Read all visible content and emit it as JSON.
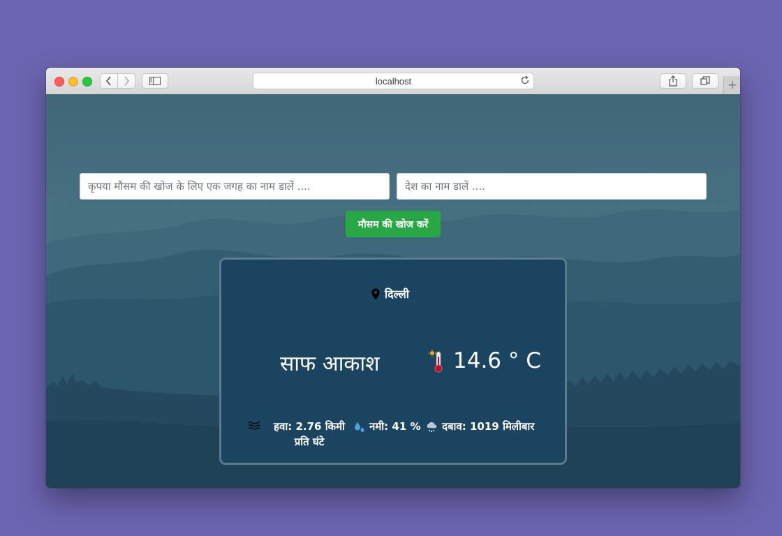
{
  "browser": {
    "address": "localhost",
    "icons": [
      "back-icon",
      "forward-icon",
      "sidebar-icon",
      "reload-icon",
      "share-icon",
      "tabs-icon",
      "plus-icon"
    ]
  },
  "search": {
    "city_placeholder": "कृपया मौसम की खोज के लिए एक जगह का नाम डालें ....",
    "country_placeholder": "देश का नाम डालें ....",
    "button_label": "मौसम की खोज करें"
  },
  "weather": {
    "location": "दिल्ली",
    "description": "साफ आकाश",
    "temperature": "14.6 ° C",
    "wind": "हवा: 2.76 किमी प्रति घंटे",
    "humidity": "नमी: 41 %",
    "pressure": "दबाव: 1019 मिलीबार"
  },
  "colors": {
    "desktop": "#6b64b0",
    "button": "#28a745",
    "card": "#1b4460",
    "page": "#4b7386"
  }
}
